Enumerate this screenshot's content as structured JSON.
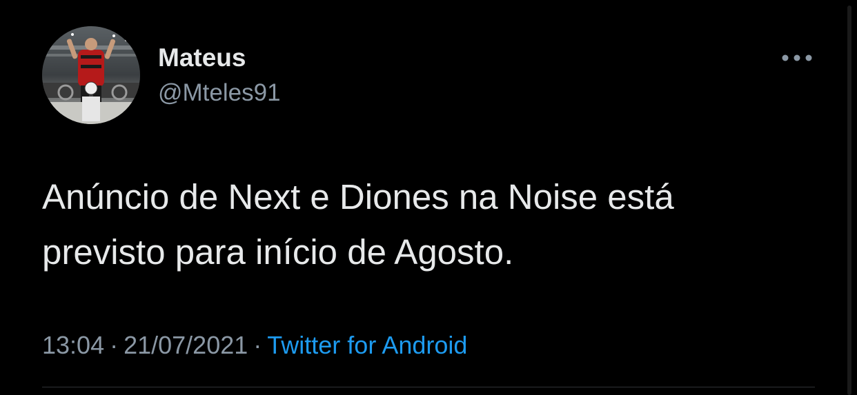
{
  "tweet": {
    "author": {
      "display_name": "Mateus",
      "handle": "@Mteles91",
      "avatar_icon": "profile-photo"
    },
    "more_icon": "more-horizontal-icon",
    "text_lines": [
      "Anúncio de Next e Diones na Noise está",
      "previsto para início de Agosto."
    ],
    "time": "13:04",
    "date": "21/07/2021",
    "separator": "·",
    "source": "Twitter for Android"
  },
  "colors": {
    "background": "#000000",
    "primary_text": "#e7e9ea",
    "secondary_text": "#8b98a5",
    "link": "#1d9bf0",
    "divider": "#2f3336"
  }
}
